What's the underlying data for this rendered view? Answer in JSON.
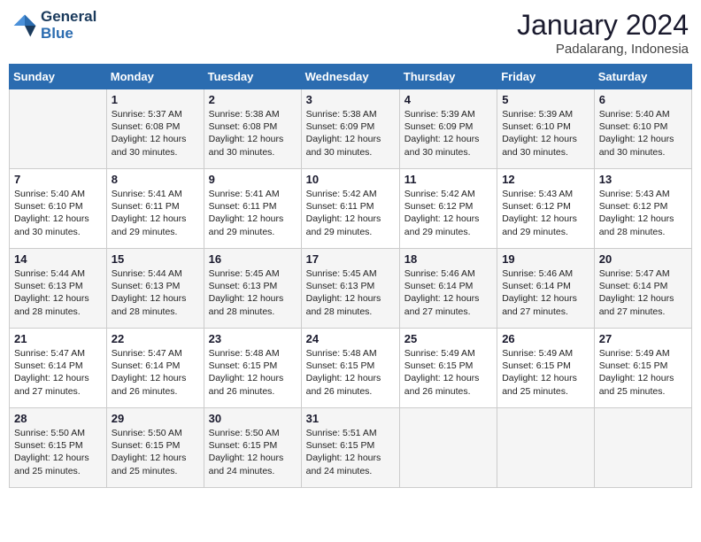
{
  "header": {
    "logo_line1": "General",
    "logo_line2": "Blue",
    "month": "January 2024",
    "location": "Padalarang, Indonesia"
  },
  "weekdays": [
    "Sunday",
    "Monday",
    "Tuesday",
    "Wednesday",
    "Thursday",
    "Friday",
    "Saturday"
  ],
  "weeks": [
    [
      {
        "day": "",
        "info": ""
      },
      {
        "day": "1",
        "info": "Sunrise: 5:37 AM\nSunset: 6:08 PM\nDaylight: 12 hours\nand 30 minutes."
      },
      {
        "day": "2",
        "info": "Sunrise: 5:38 AM\nSunset: 6:08 PM\nDaylight: 12 hours\nand 30 minutes."
      },
      {
        "day": "3",
        "info": "Sunrise: 5:38 AM\nSunset: 6:09 PM\nDaylight: 12 hours\nand 30 minutes."
      },
      {
        "day": "4",
        "info": "Sunrise: 5:39 AM\nSunset: 6:09 PM\nDaylight: 12 hours\nand 30 minutes."
      },
      {
        "day": "5",
        "info": "Sunrise: 5:39 AM\nSunset: 6:10 PM\nDaylight: 12 hours\nand 30 minutes."
      },
      {
        "day": "6",
        "info": "Sunrise: 5:40 AM\nSunset: 6:10 PM\nDaylight: 12 hours\nand 30 minutes."
      }
    ],
    [
      {
        "day": "7",
        "info": "Sunrise: 5:40 AM\nSunset: 6:10 PM\nDaylight: 12 hours\nand 30 minutes."
      },
      {
        "day": "8",
        "info": "Sunrise: 5:41 AM\nSunset: 6:11 PM\nDaylight: 12 hours\nand 29 minutes."
      },
      {
        "day": "9",
        "info": "Sunrise: 5:41 AM\nSunset: 6:11 PM\nDaylight: 12 hours\nand 29 minutes."
      },
      {
        "day": "10",
        "info": "Sunrise: 5:42 AM\nSunset: 6:11 PM\nDaylight: 12 hours\nand 29 minutes."
      },
      {
        "day": "11",
        "info": "Sunrise: 5:42 AM\nSunset: 6:12 PM\nDaylight: 12 hours\nand 29 minutes."
      },
      {
        "day": "12",
        "info": "Sunrise: 5:43 AM\nSunset: 6:12 PM\nDaylight: 12 hours\nand 29 minutes."
      },
      {
        "day": "13",
        "info": "Sunrise: 5:43 AM\nSunset: 6:12 PM\nDaylight: 12 hours\nand 28 minutes."
      }
    ],
    [
      {
        "day": "14",
        "info": "Sunrise: 5:44 AM\nSunset: 6:13 PM\nDaylight: 12 hours\nand 28 minutes."
      },
      {
        "day": "15",
        "info": "Sunrise: 5:44 AM\nSunset: 6:13 PM\nDaylight: 12 hours\nand 28 minutes."
      },
      {
        "day": "16",
        "info": "Sunrise: 5:45 AM\nSunset: 6:13 PM\nDaylight: 12 hours\nand 28 minutes."
      },
      {
        "day": "17",
        "info": "Sunrise: 5:45 AM\nSunset: 6:13 PM\nDaylight: 12 hours\nand 28 minutes."
      },
      {
        "day": "18",
        "info": "Sunrise: 5:46 AM\nSunset: 6:14 PM\nDaylight: 12 hours\nand 27 minutes."
      },
      {
        "day": "19",
        "info": "Sunrise: 5:46 AM\nSunset: 6:14 PM\nDaylight: 12 hours\nand 27 minutes."
      },
      {
        "day": "20",
        "info": "Sunrise: 5:47 AM\nSunset: 6:14 PM\nDaylight: 12 hours\nand 27 minutes."
      }
    ],
    [
      {
        "day": "21",
        "info": "Sunrise: 5:47 AM\nSunset: 6:14 PM\nDaylight: 12 hours\nand 27 minutes."
      },
      {
        "day": "22",
        "info": "Sunrise: 5:47 AM\nSunset: 6:14 PM\nDaylight: 12 hours\nand 26 minutes."
      },
      {
        "day": "23",
        "info": "Sunrise: 5:48 AM\nSunset: 6:15 PM\nDaylight: 12 hours\nand 26 minutes."
      },
      {
        "day": "24",
        "info": "Sunrise: 5:48 AM\nSunset: 6:15 PM\nDaylight: 12 hours\nand 26 minutes."
      },
      {
        "day": "25",
        "info": "Sunrise: 5:49 AM\nSunset: 6:15 PM\nDaylight: 12 hours\nand 26 minutes."
      },
      {
        "day": "26",
        "info": "Sunrise: 5:49 AM\nSunset: 6:15 PM\nDaylight: 12 hours\nand 25 minutes."
      },
      {
        "day": "27",
        "info": "Sunrise: 5:49 AM\nSunset: 6:15 PM\nDaylight: 12 hours\nand 25 minutes."
      }
    ],
    [
      {
        "day": "28",
        "info": "Sunrise: 5:50 AM\nSunset: 6:15 PM\nDaylight: 12 hours\nand 25 minutes."
      },
      {
        "day": "29",
        "info": "Sunrise: 5:50 AM\nSunset: 6:15 PM\nDaylight: 12 hours\nand 25 minutes."
      },
      {
        "day": "30",
        "info": "Sunrise: 5:50 AM\nSunset: 6:15 PM\nDaylight: 12 hours\nand 24 minutes."
      },
      {
        "day": "31",
        "info": "Sunrise: 5:51 AM\nSunset: 6:15 PM\nDaylight: 12 hours\nand 24 minutes."
      },
      {
        "day": "",
        "info": ""
      },
      {
        "day": "",
        "info": ""
      },
      {
        "day": "",
        "info": ""
      }
    ]
  ]
}
